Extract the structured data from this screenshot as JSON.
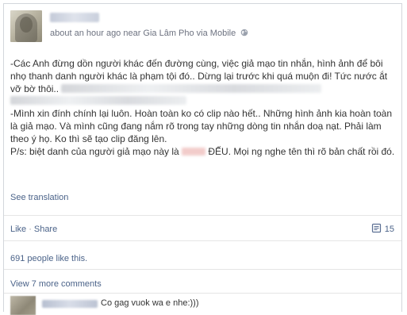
{
  "post": {
    "meta_text": "about an hour ago near Gia Lâm Pho via Mobile",
    "paragraph_1_a": "-Các Anh đừng dồn người khác đến đường cùng, việc giả mạo tin nhắn, hình ảnh để bôi nhọ thanh danh người khác là phạm tội đó.. Dừng lại trước khi quá muộn đi! Tức nước ắt vỡ bờ thôi..",
    "paragraph_2_a": "-Mình xin đính chính lại luôn. Hoàn toàn ko có clip nào hết.. Những hình ảnh kia hoàn toàn là giả mạo. Và mình cũng đang nắm rõ trong tay những dòng tin nhắn doạ nạt. Phải làm theo ý họ. Ko thì sẽ tạo clip đăng lên.",
    "paragraph_3_a": "P/s: biệt danh của người giả mạo này là ",
    "paragraph_3_b": " ĐẾU. Mọi ng nghe tên thì rõ bản chất rồi đó.",
    "see_translation": "See translation"
  },
  "actions": {
    "like": "Like",
    "separator": "·",
    "share": "Share",
    "comment_count": "15"
  },
  "likes_text": "691 people like this.",
  "view_more": "View 7 more comments",
  "comment": {
    "text": "Co gag vuok wa e nhe:)))"
  },
  "colors": {
    "link": "#4b6389",
    "text": "#333333",
    "meta": "#6d7280",
    "border": "#d3d6db"
  },
  "icons": {
    "privacy": "globe-icon",
    "comment": "comment-icon"
  }
}
